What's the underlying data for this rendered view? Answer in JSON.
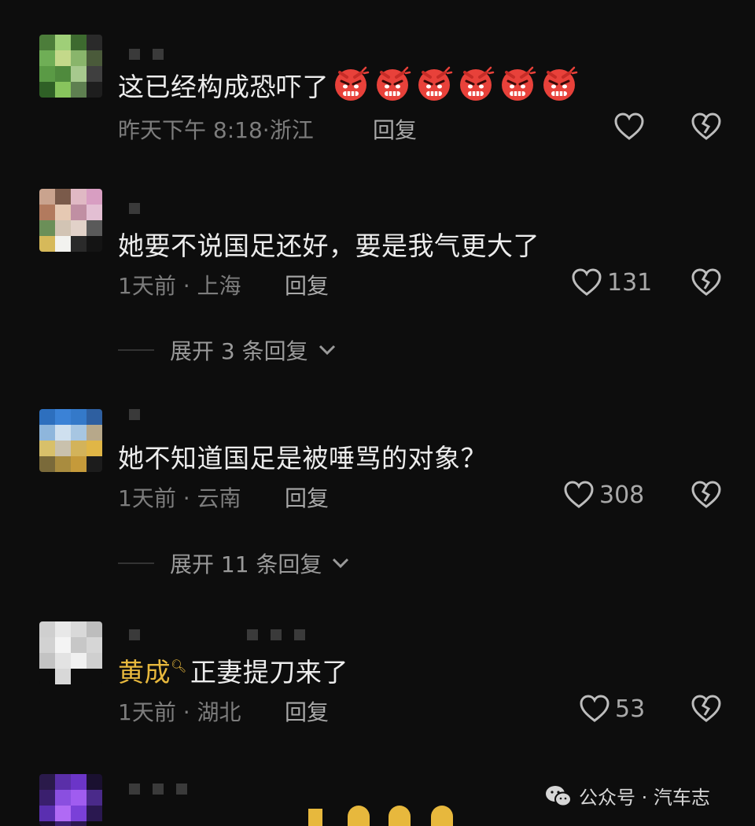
{
  "comments": [
    {
      "text": "这已经构成恐吓了",
      "emoji_count": 6,
      "time": "昨天下午 8:18",
      "location": "浙江",
      "reply_label": "回复",
      "likes": "",
      "emoji_name": "angry-face-icon"
    },
    {
      "text": "她要不说国足还好，要是我气更大了",
      "time": "1天前",
      "location": "上海",
      "reply_label": "回复",
      "likes": "131",
      "expand_label": "展开 3 条回复"
    },
    {
      "text": "她不知道国足是被唾骂的对象？",
      "time": "1天前",
      "location": "云南",
      "reply_label": "回复",
      "likes": "308",
      "expand_label": "展开 11 条回复"
    },
    {
      "mention": "黄成",
      "text": "正妻提刀来了",
      "time": "1天前",
      "location": "湖北",
      "reply_label": "回复",
      "likes": "53"
    }
  ],
  "watermark": {
    "text": "公众号 · 汽车志",
    "icon": "wechat-icon"
  },
  "colors": {
    "background": "#0d0d0d",
    "mention": "#e7b83d",
    "meta": "#7d7d7d"
  }
}
